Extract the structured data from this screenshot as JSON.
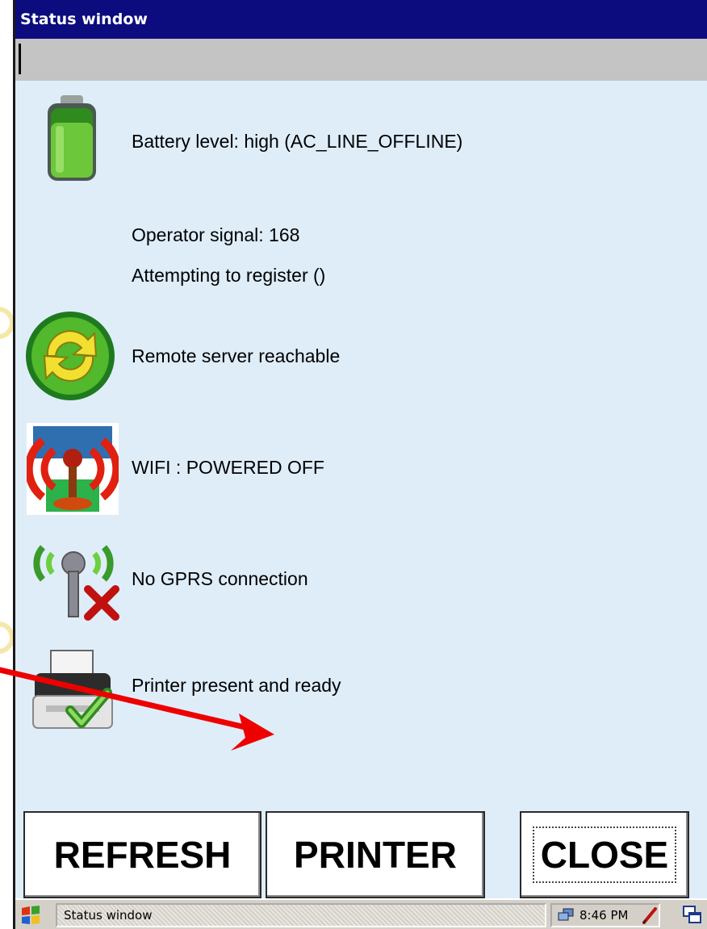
{
  "window": {
    "title": "Status window"
  },
  "status": {
    "battery": "Battery level: high (AC_LINE_OFFLINE)",
    "operator_signal": "Operator signal: 168",
    "registration": "Attempting to register ()",
    "server": "Remote server reachable",
    "wifi": "WIFI : POWERED OFF",
    "gprs": "No GPRS connection",
    "printer": "Printer present and ready"
  },
  "buttons": {
    "refresh": "REFRESH",
    "printer": "PRINTER",
    "close": "CLOSE"
  },
  "taskbar": {
    "window_label": "Status window",
    "clock": "8:46 PM"
  },
  "icons": {
    "battery": "battery-icon",
    "server": "sync-icon",
    "wifi": "wifi-antenna-icon",
    "gprs": "gprs-antenna-icon",
    "printer": "printer-icon"
  },
  "colors": {
    "titlebar": "#0c0c7e",
    "window_bg": "#dfedf9",
    "annotation_arrow": "#ee0000"
  }
}
